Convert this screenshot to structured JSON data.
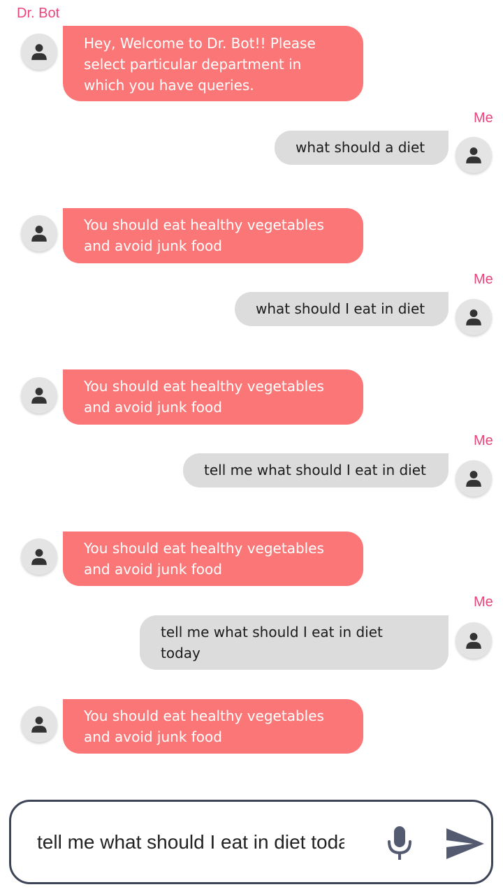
{
  "chat": {
    "bot_name": "Dr. Bot",
    "me_name": "Me",
    "messages": [
      {
        "from": "bot",
        "text": "Hey, Welcome to Dr. Bot!! Please\nselect particular department in\nwhich you have queries."
      },
      {
        "from": "me",
        "text": "what should a diet"
      },
      {
        "from": "bot",
        "text": "You should eat healthy vegetables\nand avoid junk food"
      },
      {
        "from": "me",
        "text": "what should I eat in diet"
      },
      {
        "from": "bot",
        "text": "You should eat healthy vegetables\nand avoid junk food"
      },
      {
        "from": "me",
        "text": "tell me what should I eat in diet"
      },
      {
        "from": "bot",
        "text": "You should eat healthy vegetables\nand avoid junk food"
      },
      {
        "from": "me",
        "text": "tell me what should I eat in diet\ntoday"
      },
      {
        "from": "bot",
        "text": "You should eat healthy vegetables\nand avoid junk food"
      }
    ]
  },
  "composer": {
    "value": "tell me what should I eat in diet today",
    "mic_icon": "microphone-icon",
    "send_icon": "send-icon"
  },
  "colors": {
    "bot_bubble": "#fb7777",
    "me_bubble": "#dcdcdc",
    "sender_label": "#e8457a",
    "composer_border": "#3d4458"
  }
}
